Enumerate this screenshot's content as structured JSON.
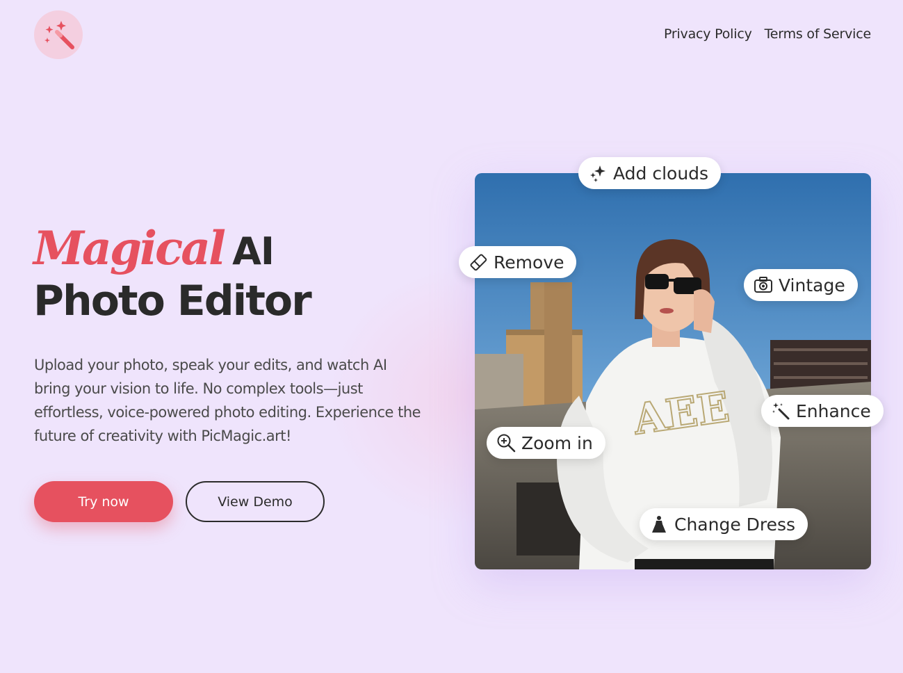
{
  "brand": {
    "logo_icon": "magic-wand-icon",
    "accent": "#e6515f",
    "background": "#efe4fc"
  },
  "nav": {
    "links": [
      "Privacy Policy",
      "Terms of Service"
    ]
  },
  "hero": {
    "title_script": "Magical",
    "title_bold": "AI",
    "title_line2": "Photo Editor",
    "description": "Upload your photo, speak your edits, and watch AI bring your vision to life. No complex tools—just effortless, voice-powered photo editing. Experience the future of creativity with PicMagic.art!",
    "primary_button": "Try now",
    "secondary_button": "View Demo"
  },
  "chips": {
    "add_clouds": {
      "label": "Add clouds",
      "icon": "sparkles-icon"
    },
    "remove": {
      "label": "Remove",
      "icon": "eraser-icon"
    },
    "vintage": {
      "label": "Vintage",
      "icon": "camera-icon"
    },
    "enhance": {
      "label": "Enhance",
      "icon": "magic-wand-icon"
    },
    "zoom_in": {
      "label": "Zoom in",
      "icon": "zoom-in-icon"
    },
    "change_dress": {
      "label": "Change Dress",
      "icon": "dress-icon"
    }
  }
}
